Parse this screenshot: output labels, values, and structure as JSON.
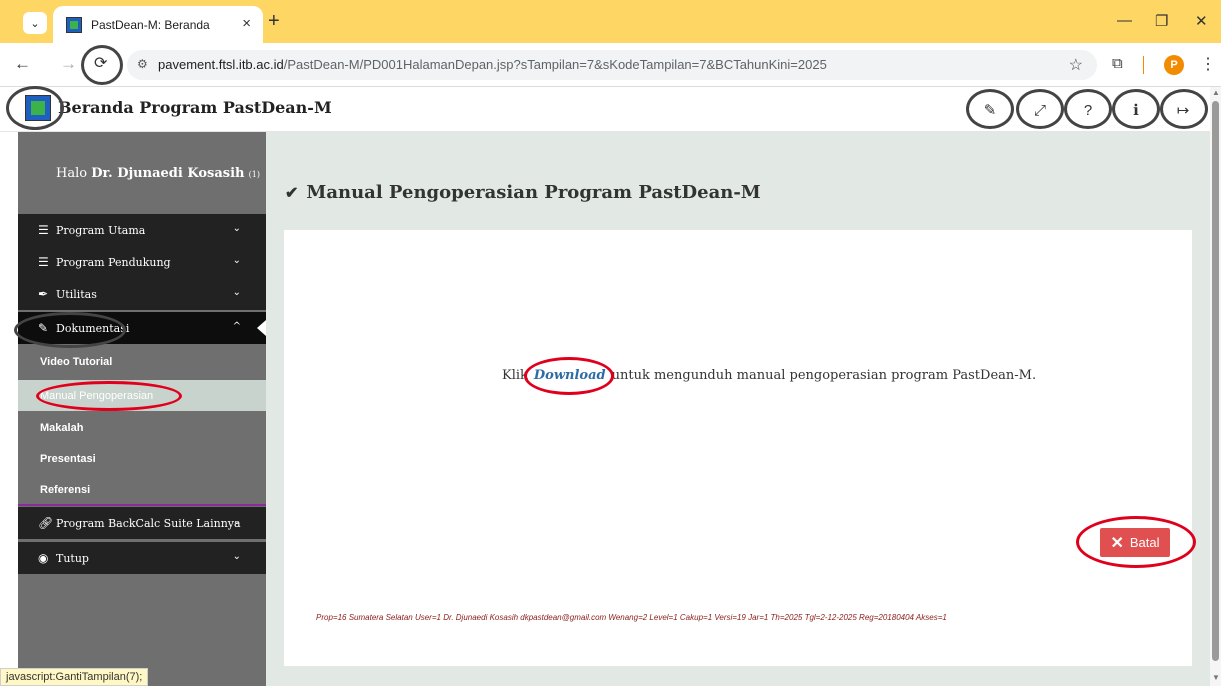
{
  "browser": {
    "tab_title": "PastDean-M: Beranda",
    "tab_close": "×",
    "new_tab": "+",
    "tab_menu_icon": "⌄",
    "url_host": "pavement.ftsl.itb.ac.id",
    "url_path": "/PastDean-M/PD001HalamanDepan.jsp?sTampilan=7&sKodeTampilan=7&BCTahunKini=2025",
    "profile_initial": "P",
    "status_url": "javascript:GantiTampilan(7);"
  },
  "header": {
    "title": "Beranda Program PastDean-M",
    "icons": [
      "pencil-icon",
      "expand-icon",
      "help-icon",
      "info-icon",
      "logout-icon"
    ]
  },
  "sidebar": {
    "greeting_prefix": "Halo",
    "user_name": "Dr. Djunaedi Kosasih",
    "user_suffix": "(1)",
    "items": [
      {
        "label": "Program Utama",
        "icon": "list-icon"
      },
      {
        "label": "Program Pendukung",
        "icon": "list-icon"
      },
      {
        "label": "Utilitas",
        "icon": "feather-icon"
      },
      {
        "label": "Dokumentasi",
        "icon": "pencil-icon"
      },
      {
        "label": "Program BackCalc Suite Lainnya",
        "icon": "link-icon"
      },
      {
        "label": "Tutup",
        "icon": "circle-icon"
      }
    ],
    "sub_items": [
      {
        "label": "Video Tutorial"
      },
      {
        "label": "Manual Pengoperasian"
      },
      {
        "label": "Makalah"
      },
      {
        "label": "Presentasi"
      },
      {
        "label": "Referensi"
      }
    ]
  },
  "main": {
    "heading": "Manual Pengoperasian Program PastDean-M",
    "instruction_prefix": "Klik",
    "download_link": "Download",
    "instruction_suffix": "untuk mengunduh manual pengoperasian program PastDean-M.",
    "cancel_label": "Batal",
    "footer_info": "Prop=16 Sumatera Selatan  User=1 Dr. Djunaedi Kosasih dkpastdean@gmail.com  Wenang=2  Level=1  Cakup=1  Versi=19  Jar=1  Th=2025  Tgl=2-12-2025  Reg=20180404  Akses=1"
  },
  "colors": {
    "tabstrip": "#fdd663",
    "sidebar_dark": "#222222",
    "sidebar_gray": "#6f6f6f",
    "content_bg": "#e2e9e4",
    "cancel_button": "#e05050",
    "link": "#2e6da4",
    "annotation_red": "#e0001b"
  }
}
